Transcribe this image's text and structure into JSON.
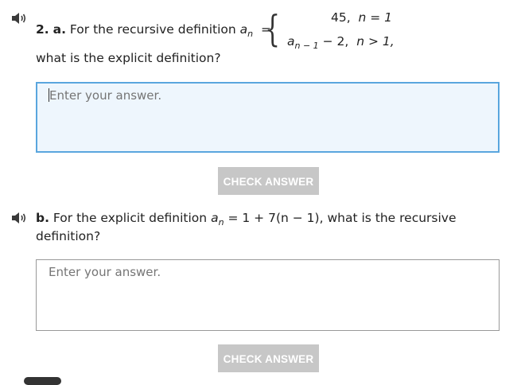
{
  "question_a": {
    "number_label": "2.",
    "part_label": "a.",
    "text_before": "For the recursive definition",
    "sequence_var": "a",
    "sequence_index": "n",
    "equals": "=",
    "case1_value": "45,",
    "case1_condition": "n = 1",
    "case2_var": "a",
    "case2_index": "n − 1",
    "case2_expr": "− 2,",
    "case2_condition": "n > 1,",
    "text_after": "what is the explicit definition?",
    "answer_placeholder": "Enter your answer.",
    "check_label": "CHECK ANSWER"
  },
  "question_b": {
    "part_label": "b.",
    "text_before": "For the explicit definition",
    "sequence_var": "a",
    "sequence_index": "n",
    "formula": "= 1 + 7(n − 1),",
    "text_after": "what is the recursive",
    "text_line2": "definition?",
    "answer_placeholder": "Enter your answer.",
    "check_label": "CHECK ANSWER"
  },
  "icons": {
    "audio": "speaker-icon"
  }
}
